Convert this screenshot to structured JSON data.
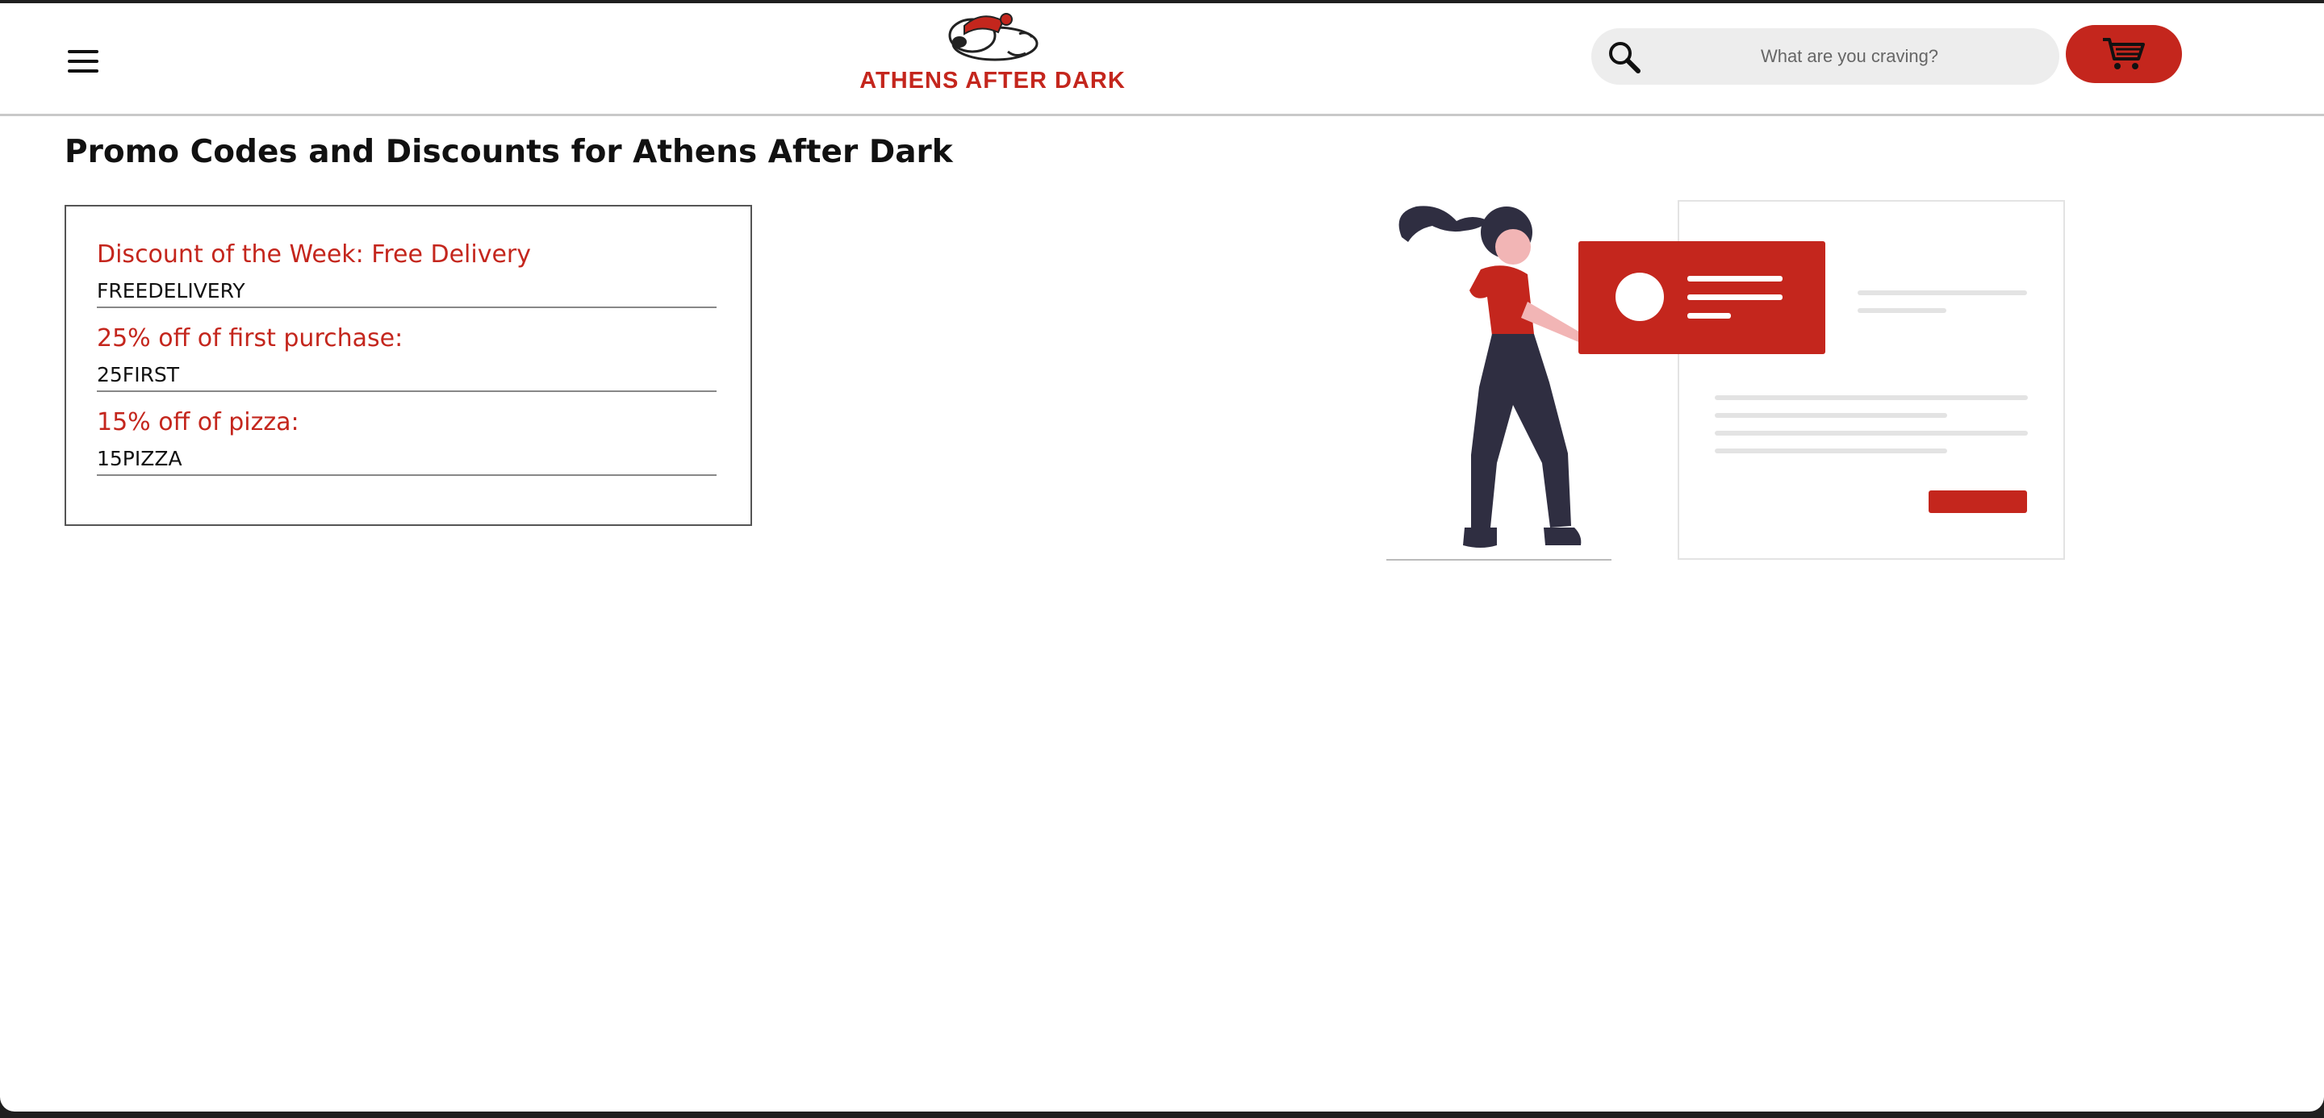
{
  "header": {
    "menu_icon": "hamburger-menu-icon",
    "logo_text": "ATHENS AFTER DARK",
    "search": {
      "placeholder": "What are you craving?",
      "value": "",
      "icon": "search-icon"
    },
    "cart_icon": "shopping-cart-icon"
  },
  "main": {
    "title": "Promo Codes and Discounts for Athens After Dark",
    "promos": [
      {
        "label": "Discount of the Week: Free Delivery",
        "code": "FREEDELIVERY"
      },
      {
        "label": "25% off of first purchase:",
        "code": "25FIRST"
      },
      {
        "label": "15% off of pizza:",
        "code": "15PIZZA"
      }
    ],
    "illustration_icon": "woman-holding-coupon-card-illustration"
  },
  "colors": {
    "accent": "#c4261d",
    "dark": "#2f2e41",
    "search_bg": "#ededed"
  }
}
